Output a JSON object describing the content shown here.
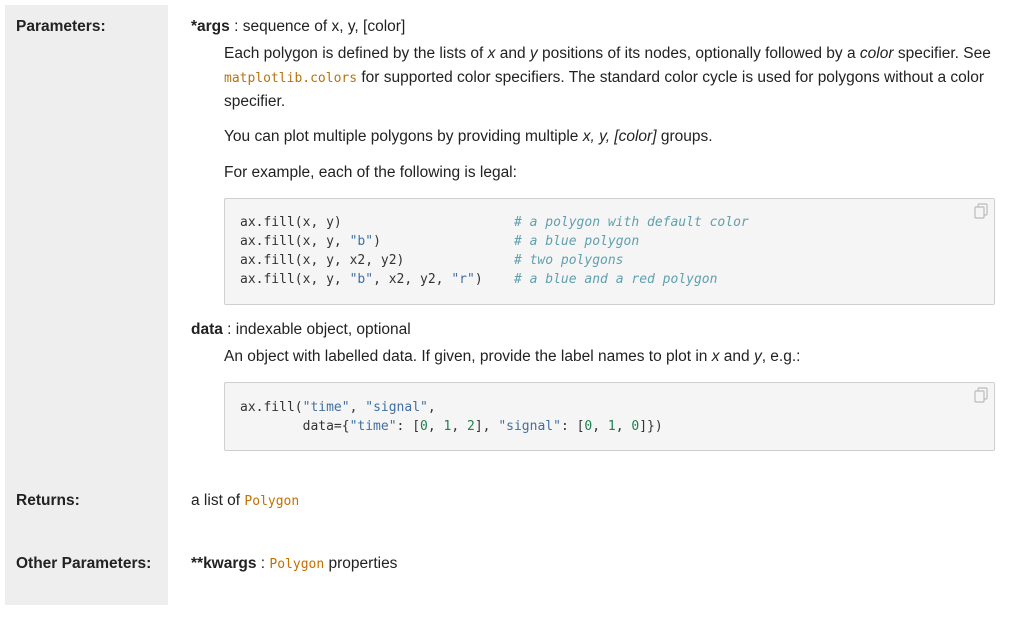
{
  "labels": {
    "parameters": "Parameters:",
    "returns": "Returns:",
    "other_parameters": "Other Parameters:"
  },
  "args": {
    "name": "*args",
    "type": "sequence of x, y, [color]",
    "p1_a": "Each polygon is defined by the lists of ",
    "p1_x": "x",
    "p1_b": " and ",
    "p1_y": "y",
    "p1_c": " positions of its nodes, optionally followed by a ",
    "p1_color": "color",
    "p1_d": " specifier. See ",
    "p1_link": "matplotlib.colors",
    "p1_e": " for supported color specifiers. The standard color cycle is used for polygons without a color specifier.",
    "p2_a": "You can plot multiple polygons by providing multiple ",
    "p2_em": "x, y, [color]",
    "p2_b": " groups.",
    "p3": "For example, each of the following is legal:",
    "code_lines": [
      {
        "code": "ax.fill(x, y)",
        "comment": "# a polygon with default color"
      },
      {
        "code": "ax.fill(x, y, \"b\")",
        "comment": "# a blue polygon"
      },
      {
        "code": "ax.fill(x, y, x2, y2)",
        "comment": "# two polygons"
      },
      {
        "code": "ax.fill(x, y, \"b\", x2, y2, \"r\")",
        "comment": "# a blue and a red polygon"
      }
    ]
  },
  "data_param": {
    "name": "data",
    "type": "indexable object, optional",
    "desc_a": "An object with labelled data. If given, provide the label names to plot in ",
    "desc_x": "x",
    "desc_b": " and ",
    "desc_y": "y",
    "desc_c": ", e.g.:",
    "code_line1": "ax.fill(\"time\", \"signal\",",
    "code_line2": "        data={\"time\": [0, 1, 2], \"signal\": [0, 1, 0]})"
  },
  "returns": {
    "text": "a list of ",
    "type": "Polygon"
  },
  "kwargs": {
    "name": "**kwargs",
    "sep": " : ",
    "type": "Polygon",
    "tail": " properties"
  },
  "colors": {
    "label_bg": "#eeeeee",
    "code_bg": "#f5f5f5",
    "literal": "#c46f00",
    "string": "#4070a0",
    "number": "#208050",
    "comment": "#60a0b0"
  },
  "icons": [
    "copy-icon"
  ]
}
